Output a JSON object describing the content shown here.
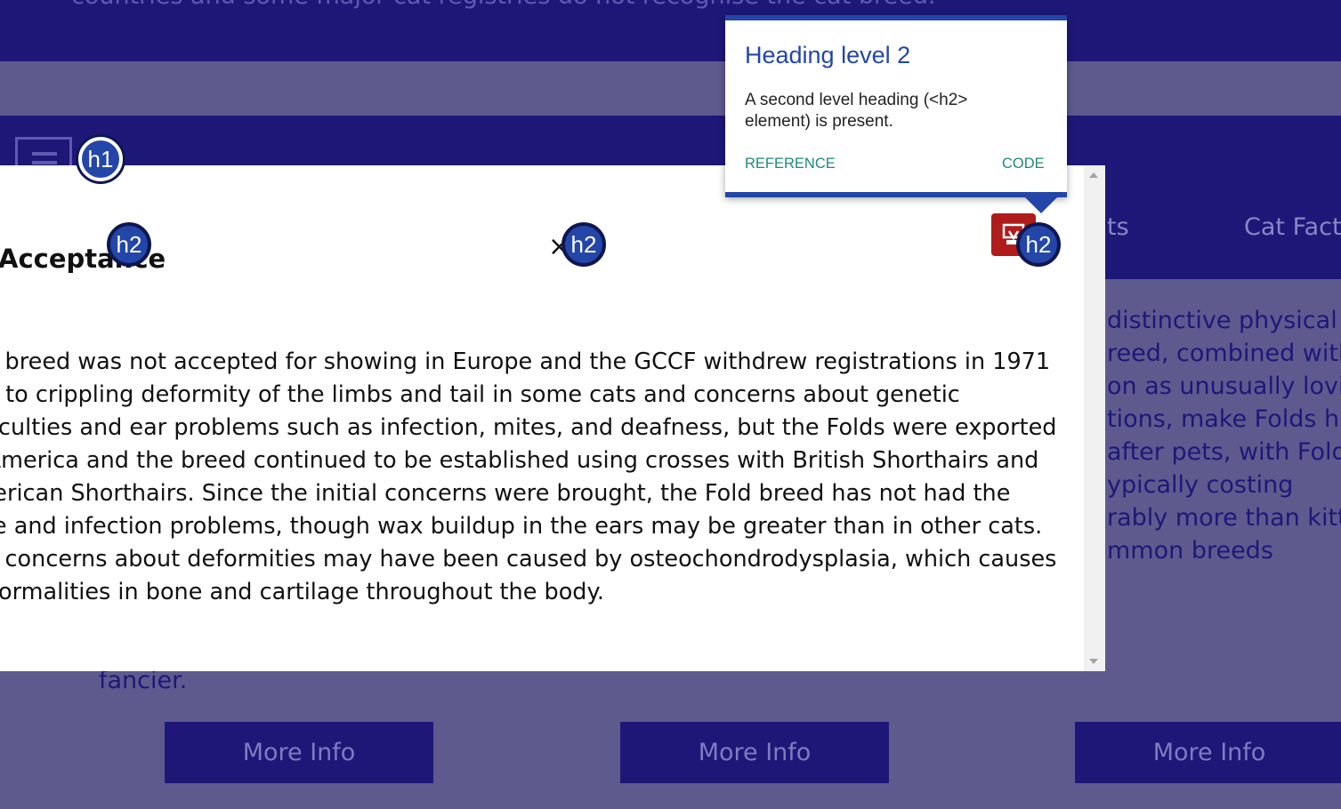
{
  "page": {
    "top_text": "countries and some major cat registries do not recognise the cat breed.",
    "nav": {
      "item_partial": "ts",
      "item_cat_facts": "Cat Facts"
    },
    "right_column_lines": [
      "distinctive physical t",
      "reed, combined with t",
      "on as unusually lovin",
      "tions, make Folds high",
      "after pets, with Fold",
      "ypically costing",
      "rably more than kitte",
      "mmon breeds"
    ],
    "fancier_text": "fancier.",
    "more_info_buttons": [
      "More Info",
      "More Info",
      "More Info"
    ]
  },
  "modal": {
    "heading": "Acceptance",
    "close_glyph": "×",
    "body_lines": [
      "The breed was not accepted for showing in Europe and the GCCF withdrew registrations in 1971",
      "due to crippling deformity of the limbs and tail in some cats and concerns about genetic",
      "difficulties and ear problems such as infection, mites, and deafness, but the Folds were exported",
      "to America and the breed continued to be established using crosses with British Shorthairs and",
      "American Shorthairs. Since the initial concerns were brought, the Fold breed has not had the",
      "mite and infection problems, though wax buildup in the ears may be greater than in other cats.",
      "The concerns about deformities may have been caused by osteochondrodysplasia, which causes",
      "abnormalities in bone and cartilage throughout the body."
    ]
  },
  "badges": {
    "h1": "h1",
    "h2_a": "h2",
    "h2_b": "h2",
    "h2_c": "h2"
  },
  "tooltip": {
    "title": "Heading level 2",
    "description": "A second level heading (<h2> element) is present.",
    "reference_label": "REFERENCE",
    "code_label": "CODE"
  },
  "colors": {
    "page_bg": "#5f5a8e",
    "dark_band": "#1d1878",
    "badge_blue": "#2346a8",
    "link_teal": "#1e8a7a",
    "print_red": "#b01c1c"
  },
  "icons": [
    "logo-icon",
    "close-icon",
    "print-icon",
    "scroll-up-icon",
    "scroll-down-icon"
  ]
}
